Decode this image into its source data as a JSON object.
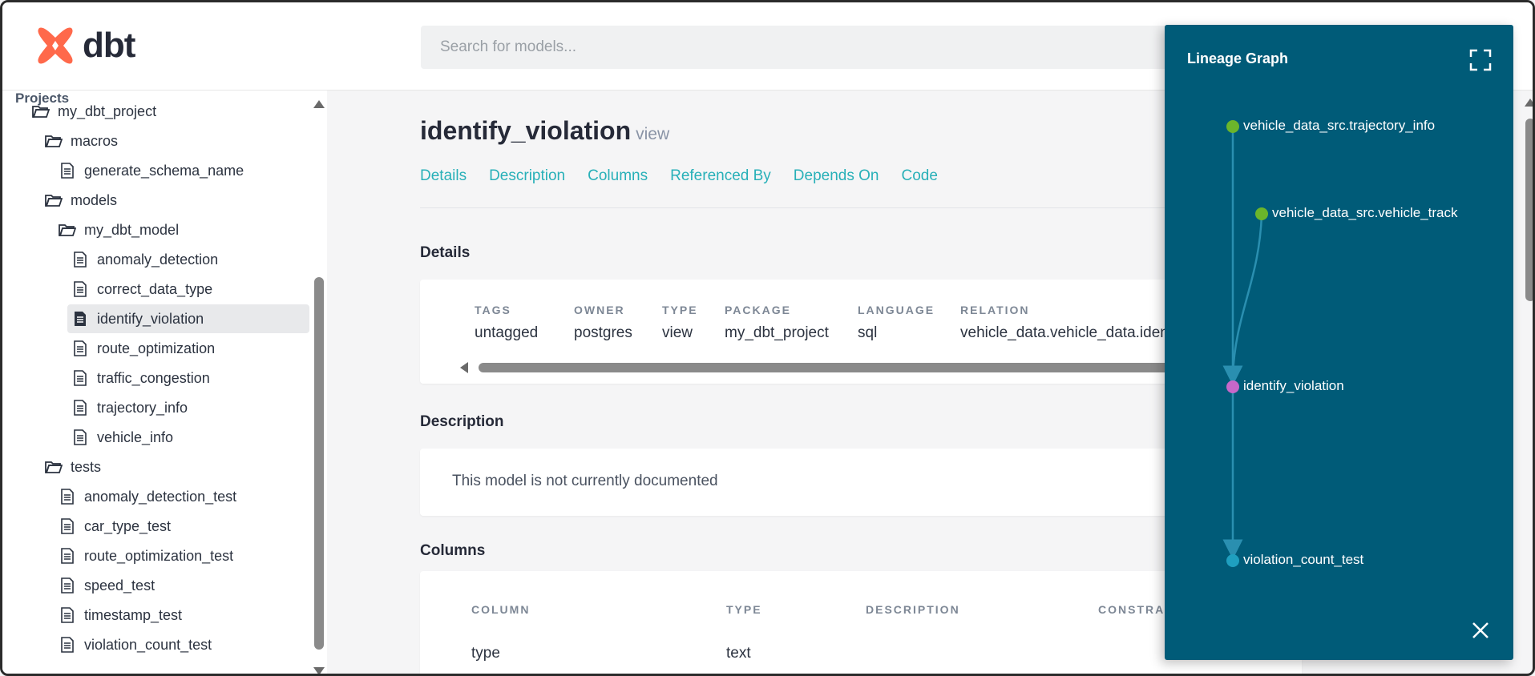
{
  "app": {
    "logo_text": "dbt",
    "brand_color": "#ff694b"
  },
  "search": {
    "placeholder": "Search for models..."
  },
  "sidebar": {
    "heading": "Projects",
    "items": [
      {
        "label": "my_dbt_project",
        "type": "folder-open"
      },
      {
        "label": "macros",
        "type": "folder-open"
      },
      {
        "label": "generate_schema_name",
        "type": "file"
      },
      {
        "label": "models",
        "type": "folder-open"
      },
      {
        "label": "my_dbt_model",
        "type": "folder-open"
      },
      {
        "label": "anomaly_detection",
        "type": "file"
      },
      {
        "label": "correct_data_type",
        "type": "file"
      },
      {
        "label": "identify_violation",
        "type": "file",
        "active": true
      },
      {
        "label": "route_optimization",
        "type": "file"
      },
      {
        "label": "traffic_congestion",
        "type": "file"
      },
      {
        "label": "trajectory_info",
        "type": "file"
      },
      {
        "label": "vehicle_info",
        "type": "file"
      },
      {
        "label": "tests",
        "type": "folder-open"
      },
      {
        "label": "anomaly_detection_test",
        "type": "file"
      },
      {
        "label": "car_type_test",
        "type": "file"
      },
      {
        "label": "route_optimization_test",
        "type": "file"
      },
      {
        "label": "speed_test",
        "type": "file"
      },
      {
        "label": "timestamp_test",
        "type": "file"
      },
      {
        "label": "violation_count_test",
        "type": "file"
      }
    ]
  },
  "main": {
    "title": "identify_violation",
    "kind": "view",
    "tabs": [
      "Details",
      "Description",
      "Columns",
      "Referenced By",
      "Depends On",
      "Code"
    ],
    "details": {
      "heading": "Details",
      "fields": [
        {
          "label": "TAGS",
          "value": "untagged"
        },
        {
          "label": "OWNER",
          "value": "postgres"
        },
        {
          "label": "TYPE",
          "value": "view"
        },
        {
          "label": "PACKAGE",
          "value": "my_dbt_project"
        },
        {
          "label": "LANGUAGE",
          "value": "sql"
        },
        {
          "label": "RELATION",
          "value": "vehicle_data.vehicle_data.ident"
        }
      ]
    },
    "description": {
      "heading": "Description",
      "text": "This model is not currently documented"
    },
    "columns": {
      "heading": "Columns",
      "headers": [
        "COLUMN",
        "TYPE",
        "DESCRIPTION",
        "CONSTRAI"
      ],
      "rows": [
        [
          "type",
          "text",
          "",
          ""
        ]
      ]
    }
  },
  "lineage": {
    "title": "Lineage Graph",
    "panel_color": "#005b78",
    "nodes": [
      {
        "label": "vehicle_data_src.trajectory_info",
        "color": "#6bb52b",
        "role": "source"
      },
      {
        "label": "vehicle_data_src.vehicle_track",
        "color": "#6bb52b",
        "role": "source"
      },
      {
        "label": "identify_violation",
        "color": "#c768c9",
        "role": "current"
      },
      {
        "label": "violation_count_test",
        "color": "#1f9fbf",
        "role": "test"
      }
    ]
  }
}
